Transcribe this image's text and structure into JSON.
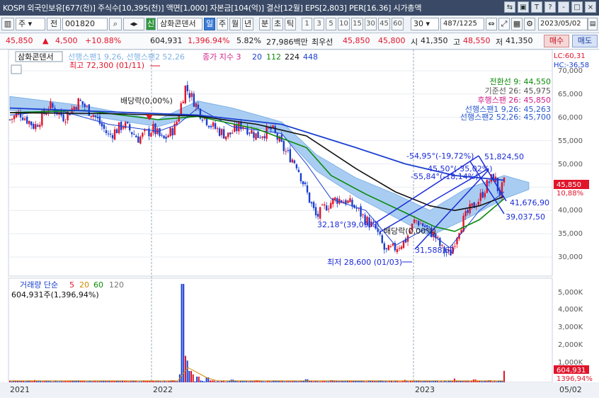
{
  "window": {
    "title": "KOSPI 외국인보유[677(천)] 주식수[10,395(천)] 액면[1,000] 자본금[104(억)] 결산[12월] EPS[2,803] PER[16.36] 시가총액",
    "buttons": [
      "⇆",
      "▣",
      "T",
      "?",
      "-",
      "□",
      "×"
    ]
  },
  "toolbar": {
    "board_label": "주",
    "prev_label": "전",
    "code_value": "001820",
    "stock_name": "삼화콘덴서",
    "period_tabs": [
      "일",
      "주",
      "월",
      "년",
      "분",
      "초",
      "틱"
    ],
    "active_period": "일",
    "interval_buttons": [
      "1",
      "3",
      "5",
      "10",
      "15",
      "30",
      "45",
      "60"
    ],
    "count_value": "30",
    "position_value": "487",
    "total_count": "/1225",
    "date_value": "2023/05/02",
    "sin_label": "신"
  },
  "quote": {
    "price": "45,850",
    "change_arrow": "▲",
    "change": "4,500",
    "change_pct": "+10.88%",
    "volume": "604,931",
    "volume_ratio": "1,396.94%",
    "turnover": "5.82%",
    "amount": "27,986백만",
    "best_label": "최우선",
    "best_ask": "45,850",
    "best_bid": "45,800",
    "open_label": "시",
    "open": "41,350",
    "high_label": "고",
    "high": "48,550",
    "low_label": "저",
    "low": "41,350",
    "buy_label": "매수",
    "sell_label": "매도"
  },
  "chart_panel": {
    "name_tab": "삼화콘덴서",
    "ichimoku_caption": "선행스팬1 9,26, 선행스팬2 52,26",
    "ma_label": "종가 지수 3",
    "ma_periods": [
      "20",
      "112",
      "224",
      "448"
    ],
    "ma_colors": [
      "#1a3fd0",
      "#0a8a0a",
      "#111111",
      "#1a3fd0"
    ],
    "lc_label": "LC:60,31",
    "hc_label": "HC:-36,58",
    "high_note": "최고 72,300 (01/11)",
    "low_note": "최저 28,600 (01/03)",
    "div_note_1": "배당락(0,00%)",
    "div_note_2": "배당락(0,00%)",
    "legend_lines": [
      {
        "text": "전환선 9: 44,550",
        "color": "#0a8a0a"
      },
      {
        "text": "기준선 26: 45,975",
        "color": "#555555"
      },
      {
        "text": "후행스팬 26: 45,850",
        "color": "#d0208a"
      },
      {
        "text": "선행스팬1 9,26: 45,263",
        "color": "#2a5ad0"
      },
      {
        "text": "선행스팬2 52,26: 45,700",
        "color": "#2a5ad0"
      }
    ],
    "trend_notes": [
      "-54,95°(-19,72%)",
      "45,50°(-35,02%)",
      "-55,84°(-18,14%)",
      "51,824,50",
      "32,18°(39,09%)",
      "41,676,90",
      "39,037,50",
      "31,588,60"
    ],
    "price_badge": "45,850",
    "pct_badge": "10,88%",
    "price_axis_labels": [
      "70,000",
      "65,000",
      "60,000",
      "55,000",
      "50,000",
      "45,000",
      "40,000",
      "35,000",
      "30,000"
    ],
    "volume_label": "거래량 단순",
    "volume_periods": [
      "5",
      "20",
      "60",
      "120"
    ],
    "volume_period_colors": [
      "#e0142a",
      "#d08a00",
      "#0a8a0a",
      "#777777"
    ],
    "volume_text": "604,931주(1,396,94%)",
    "volume_axis_labels": [
      "5,000K",
      "4,000K",
      "3,000K",
      "2,000K",
      "1,000K"
    ],
    "volume_badge": "604,931",
    "volume_pct_badge": "1396,94%",
    "x_labels": [
      "2021",
      "2022",
      "2023"
    ],
    "x_right_label": "05/02"
  },
  "chart_data": {
    "type": "candlestick",
    "x_range": [
      "2021",
      "2023/05/02"
    ],
    "ylim": [
      28000,
      72500
    ],
    "close_path": [
      {
        "t": 0.0,
        "v": 59500
      },
      {
        "t": 0.02,
        "v": 61000
      },
      {
        "t": 0.05,
        "v": 58000
      },
      {
        "t": 0.08,
        "v": 62500
      },
      {
        "t": 0.11,
        "v": 60000
      },
      {
        "t": 0.14,
        "v": 63500
      },
      {
        "t": 0.17,
        "v": 60500
      },
      {
        "t": 0.2,
        "v": 56000
      },
      {
        "t": 0.23,
        "v": 58500
      },
      {
        "t": 0.26,
        "v": 55500
      },
      {
        "t": 0.29,
        "v": 57500
      },
      {
        "t": 0.31,
        "v": 55000
      },
      {
        "t": 0.335,
        "v": 58000
      },
      {
        "t": 0.355,
        "v": 66500
      },
      {
        "t": 0.37,
        "v": 64000
      },
      {
        "t": 0.385,
        "v": 61000
      },
      {
        "t": 0.41,
        "v": 58000
      },
      {
        "t": 0.44,
        "v": 56000
      },
      {
        "t": 0.47,
        "v": 58500
      },
      {
        "t": 0.5,
        "v": 56000
      },
      {
        "t": 0.53,
        "v": 57500
      },
      {
        "t": 0.555,
        "v": 53000
      },
      {
        "t": 0.58,
        "v": 50000
      },
      {
        "t": 0.6,
        "v": 44000
      },
      {
        "t": 0.62,
        "v": 38500
      },
      {
        "t": 0.64,
        "v": 41000
      },
      {
        "t": 0.66,
        "v": 42500
      },
      {
        "t": 0.68,
        "v": 42000
      },
      {
        "t": 0.7,
        "v": 40500
      },
      {
        "t": 0.72,
        "v": 38000
      },
      {
        "t": 0.74,
        "v": 36000
      },
      {
        "t": 0.76,
        "v": 31000
      },
      {
        "t": 0.78,
        "v": 32000
      },
      {
        "t": 0.8,
        "v": 33500
      },
      {
        "t": 0.82,
        "v": 38000
      },
      {
        "t": 0.84,
        "v": 36500
      },
      {
        "t": 0.86,
        "v": 34500
      },
      {
        "t": 0.875,
        "v": 31500
      },
      {
        "t": 0.89,
        "v": 30500
      },
      {
        "t": 0.91,
        "v": 36500
      },
      {
        "t": 0.93,
        "v": 40000
      },
      {
        "t": 0.95,
        "v": 42500
      },
      {
        "t": 0.965,
        "v": 45500
      },
      {
        "t": 0.98,
        "v": 47500
      },
      {
        "t": 0.99,
        "v": 43500
      },
      {
        "t": 1.0,
        "v": 45850
      }
    ],
    "ma20": [
      {
        "t": 0.0,
        "v": 60500
      },
      {
        "t": 0.1,
        "v": 61500
      },
      {
        "t": 0.2,
        "v": 58500
      },
      {
        "t": 0.3,
        "v": 57000
      },
      {
        "t": 0.34,
        "v": 58500
      },
      {
        "t": 0.38,
        "v": 62000
      },
      {
        "t": 0.45,
        "v": 58000
      },
      {
        "t": 0.55,
        "v": 56500
      },
      {
        "t": 0.6,
        "v": 50000
      },
      {
        "t": 0.65,
        "v": 42500
      },
      {
        "t": 0.72,
        "v": 40000
      },
      {
        "t": 0.78,
        "v": 32500
      },
      {
        "t": 0.84,
        "v": 36000
      },
      {
        "t": 0.89,
        "v": 32000
      },
      {
        "t": 0.95,
        "v": 40000
      },
      {
        "t": 1.0,
        "v": 44000
      }
    ],
    "ma112": [
      {
        "t": 0.0,
        "v": 61000
      },
      {
        "t": 0.15,
        "v": 61500
      },
      {
        "t": 0.3,
        "v": 59500
      },
      {
        "t": 0.38,
        "v": 60200
      },
      {
        "t": 0.5,
        "v": 57500
      },
      {
        "t": 0.6,
        "v": 53500
      },
      {
        "t": 0.65,
        "v": 47500
      },
      {
        "t": 0.72,
        "v": 43500
      },
      {
        "t": 0.8,
        "v": 39500
      },
      {
        "t": 0.86,
        "v": 36500
      },
      {
        "t": 0.9,
        "v": 35500
      },
      {
        "t": 0.95,
        "v": 38000
      },
      {
        "t": 1.0,
        "v": 42500
      }
    ],
    "ma224": [
      {
        "t": 0.0,
        "v": 61000
      },
      {
        "t": 0.2,
        "v": 60800
      },
      {
        "t": 0.38,
        "v": 60300
      },
      {
        "t": 0.5,
        "v": 58500
      },
      {
        "t": 0.6,
        "v": 56000
      },
      {
        "t": 0.7,
        "v": 49000
      },
      {
        "t": 0.78,
        "v": 44000
      },
      {
        "t": 0.85,
        "v": 41000
      },
      {
        "t": 0.9,
        "v": 40000
      },
      {
        "t": 0.95,
        "v": 41000
      },
      {
        "t": 1.0,
        "v": 43000
      }
    ],
    "ma448": [
      {
        "t": 0.0,
        "v": 62000
      },
      {
        "t": 0.2,
        "v": 61200
      },
      {
        "t": 0.38,
        "v": 60500
      },
      {
        "t": 0.55,
        "v": 58500
      },
      {
        "t": 0.7,
        "v": 53500
      },
      {
        "t": 0.8,
        "v": 50000
      },
      {
        "t": 0.9,
        "v": 47500
      },
      {
        "t": 1.0,
        "v": 46500
      }
    ],
    "cloud_top": [
      {
        "t": 0.0,
        "v": 64500
      },
      {
        "t": 0.15,
        "v": 62500
      },
      {
        "t": 0.3,
        "v": 59500
      },
      {
        "t": 0.38,
        "v": 63500
      },
      {
        "t": 0.45,
        "v": 62000
      },
      {
        "t": 0.55,
        "v": 59000
      },
      {
        "t": 0.62,
        "v": 52000
      },
      {
        "t": 0.7,
        "v": 47000
      },
      {
        "t": 0.78,
        "v": 43500
      },
      {
        "t": 0.85,
        "v": 40000
      },
      {
        "t": 0.92,
        "v": 44500
      },
      {
        "t": 1.0,
        "v": 47500
      },
      {
        "t": 1.05,
        "v": 46000
      }
    ],
    "cloud_bottom": [
      {
        "t": 0.0,
        "v": 61500
      },
      {
        "t": 0.15,
        "v": 60500
      },
      {
        "t": 0.3,
        "v": 58000
      },
      {
        "t": 0.38,
        "v": 60500
      },
      {
        "t": 0.45,
        "v": 59000
      },
      {
        "t": 0.55,
        "v": 56500
      },
      {
        "t": 0.62,
        "v": 48500
      },
      {
        "t": 0.7,
        "v": 43000
      },
      {
        "t": 0.78,
        "v": 38500
      },
      {
        "t": 0.85,
        "v": 34500
      },
      {
        "t": 0.92,
        "v": 38000
      },
      {
        "t": 1.0,
        "v": 42500
      },
      {
        "t": 1.05,
        "v": 44500
      }
    ],
    "volume_bars": [
      {
        "t": 0.05,
        "v": 120
      },
      {
        "t": 0.12,
        "v": 90
      },
      {
        "t": 0.2,
        "v": 70
      },
      {
        "t": 0.28,
        "v": 80
      },
      {
        "t": 0.33,
        "v": 110
      },
      {
        "t": 0.345,
        "v": 420
      },
      {
        "t": 0.35,
        "v": 5200
      },
      {
        "t": 0.355,
        "v": 1400
      },
      {
        "t": 0.36,
        "v": 1150
      },
      {
        "t": 0.365,
        "v": 600
      },
      {
        "t": 0.37,
        "v": 420
      },
      {
        "t": 0.38,
        "v": 300
      },
      {
        "t": 0.4,
        "v": 260
      },
      {
        "t": 0.45,
        "v": 140
      },
      {
        "t": 0.5,
        "v": 110
      },
      {
        "t": 0.55,
        "v": 90
      },
      {
        "t": 0.6,
        "v": 160
      },
      {
        "t": 0.65,
        "v": 110
      },
      {
        "t": 0.7,
        "v": 90
      },
      {
        "t": 0.75,
        "v": 100
      },
      {
        "t": 0.8,
        "v": 130
      },
      {
        "t": 0.85,
        "v": 90
      },
      {
        "t": 0.9,
        "v": 200
      },
      {
        "t": 0.94,
        "v": 150
      },
      {
        "t": 0.97,
        "v": 110
      },
      {
        "t": 1.0,
        "v": 605
      }
    ],
    "volume_ylim": [
      0,
      5200
    ]
  }
}
